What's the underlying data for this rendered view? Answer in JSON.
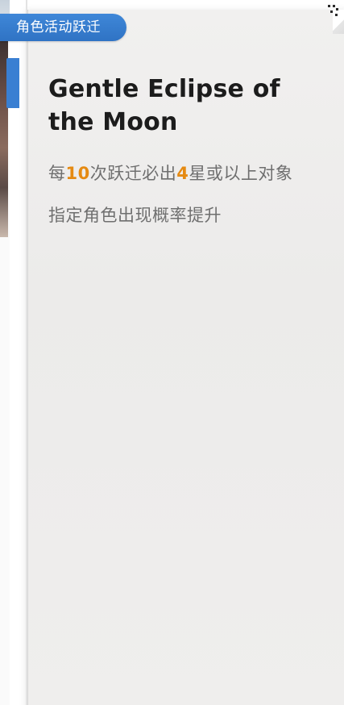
{
  "badge": {
    "label": "角色活动跃迁"
  },
  "banner": {
    "title": "Gentle Eclipse of the Moon",
    "rule_line1": {
      "prefix": "每",
      "count": "10",
      "middle": "次跃迁必出",
      "stars": "4",
      "suffix": "星或以上对象"
    },
    "rule_line2": "指定角色出现概率提升"
  },
  "colors": {
    "badge_blue": "#3a7fd2",
    "highlight_orange": "#e58a12",
    "panel_bg": "#efeeed"
  }
}
